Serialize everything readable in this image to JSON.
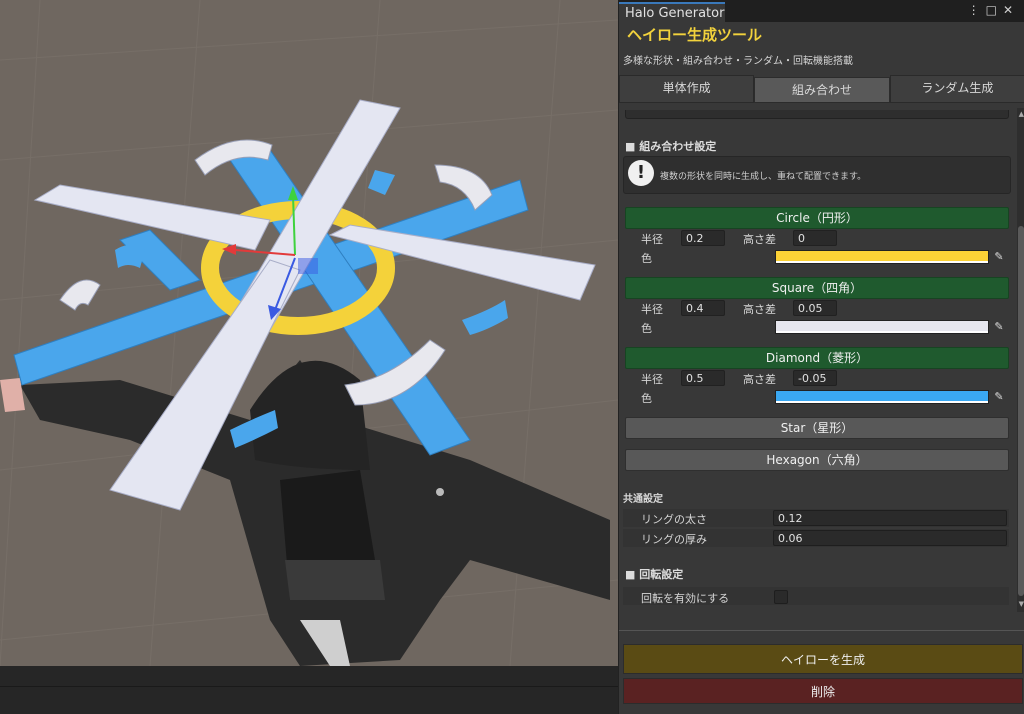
{
  "window": {
    "tab_title": "Halo Generator",
    "icons": [
      "more-icon",
      "maximize-icon",
      "close-icon"
    ]
  },
  "header": {
    "title": "ヘイロー生成ツール",
    "subtitle": "多様な形状・組み合わせ・ランダム・回転機能搭載"
  },
  "tabs": [
    {
      "label": "単体作成",
      "active": false
    },
    {
      "label": "組み合わせ",
      "active": true
    },
    {
      "label": "ランダム生成",
      "active": false
    }
  ],
  "combo_section": {
    "heading": "■ 組み合わせ設定",
    "help_text": "複数の形状を同時に生成し、重ねて配置できます。"
  },
  "shapes": [
    {
      "label": "Circle（円形）",
      "enabled": true,
      "radius_label": "半径",
      "radius": "0.2",
      "height_label": "高さ差",
      "height": "0",
      "color_label": "色",
      "color": "#fcd236"
    },
    {
      "label": "Square（四角）",
      "enabled": true,
      "radius_label": "半径",
      "radius": "0.4",
      "height_label": "高さ差",
      "height": "0.05",
      "color_label": "色",
      "color": "#e6e6ee"
    },
    {
      "label": "Diamond（菱形）",
      "enabled": true,
      "radius_label": "半径",
      "radius": "0.5",
      "height_label": "高さ差",
      "height": "-0.05",
      "color_label": "色",
      "color": "#3aa8f2"
    },
    {
      "label": "Star（星形）",
      "enabled": false
    },
    {
      "label": "Hexagon（六角）",
      "enabled": false
    }
  ],
  "common": {
    "heading": "共通設定",
    "ring_width_label": "リングの太さ",
    "ring_width": "0.12",
    "ring_depth_label": "リングの厚み",
    "ring_depth": "0.06"
  },
  "rotation": {
    "heading": "■ 回転設定",
    "enable_label": "回転を有効にする",
    "enabled": false
  },
  "actions": {
    "generate_label": "ヘイローを生成",
    "delete_label": "削除"
  },
  "colors": {
    "generate_bg": "#5a4b14",
    "delete_bg": "#5a2222",
    "enabled_shape_bg": "#1f5a2e",
    "title": "#f2d23c"
  }
}
